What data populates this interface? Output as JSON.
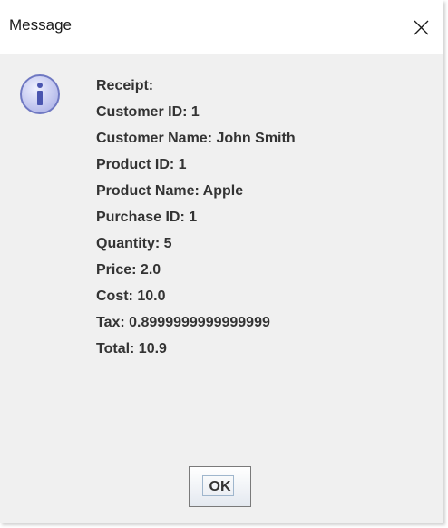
{
  "window": {
    "title": "Message",
    "close_symbol": "✕"
  },
  "icon": "info-icon",
  "message": {
    "lines": [
      "Receipt:",
      "Customer ID: 1",
      "Customer Name: John Smith",
      "Product ID: 1",
      "Product Name: Apple",
      "Purchase ID: 1",
      "Quantity: 5",
      "Price: 2.0",
      "Cost: 10.0",
      "Tax: 0.8999999999999999",
      "Total: 10.9"
    ]
  },
  "buttons": {
    "ok_label": "OK"
  },
  "colors": {
    "dialog_bg": "#f0f0f0",
    "titlebar_bg": "#ffffff",
    "text": "#333333",
    "icon_fill": "#c8cdf0",
    "icon_stroke": "#6f78c2"
  }
}
